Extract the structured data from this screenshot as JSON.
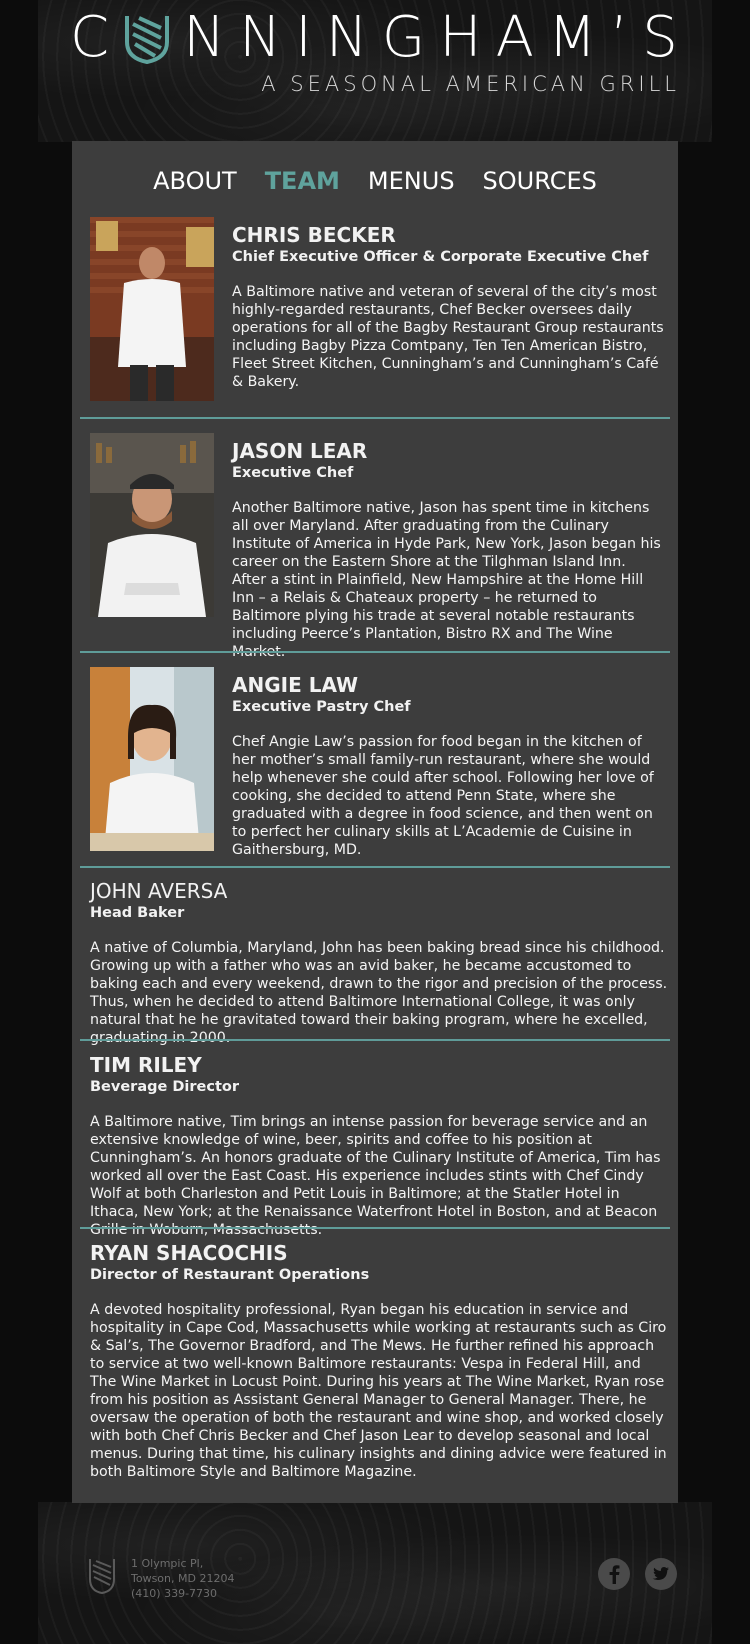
{
  "brand": {
    "letters_left": "C",
    "letters_right": [
      "N",
      "N",
      "I",
      "N",
      "G",
      "H",
      "A",
      "M",
      "’",
      "S"
    ],
    "tagline": "A SEASONAL AMERICAN GRILL",
    "accent_color": "#5fa39d"
  },
  "nav": {
    "items": [
      {
        "label": "ABOUT",
        "active": false
      },
      {
        "label": "TEAM",
        "active": true
      },
      {
        "label": "MENUS",
        "active": false
      },
      {
        "label": "SOURCES",
        "active": false
      }
    ]
  },
  "team": [
    {
      "name": "CHRIS BECKER",
      "role": "Chief Executive Officer & Corporate Executive Chef",
      "bio": "A Baltimore native and veteran of several of the city’s most highly-regarded restaurants, Chef Becker oversees daily operations for all of the Bagby Restaurant Group restaurants including Bagby Pizza Comtpany, Ten Ten American Bistro, Fleet Street Kitchen, Cunningham’s and Cunningham’s Café & Bakery."
    },
    {
      "name": "JASON LEAR",
      "role": "Executive Chef",
      "bio": "Another Baltimore native, Jason has spent time in kitchens all over Maryland. After graduating from the Culinary Institute of America in Hyde Park, New York, Jason began his career on the Eastern Shore at the Tilghman Island Inn. After a stint in Plainfield, New Hampshire at the Home Hill Inn – a Relais & Chateaux property – he returned to Baltimore plying his trade at several notable restaurants including Peerce’s Plantation, Bistro RX and The Wine Market."
    },
    {
      "name": "ANGIE LAW",
      "role": "Executive Pastry Chef",
      "bio": "Chef Angie Law’s passion for food began in the kitchen of her mother’s small family-run restaurant, where she would help whenever she could after school. Following her love of cooking, she decided to attend Penn State, where she graduated with a degree in food science, and then went on to perfect her culinary skills at L’Academie de Cuisine in Gaithersburg, MD."
    },
    {
      "name": "JOHN AVERSA",
      "role": "Head Baker",
      "bio": "A native of Columbia, Maryland, John has been baking bread since his childhood. Growing up with a father who was an avid baker, he became accustomed to baking each and every weekend, drawn to the rigor and precision of the process. Thus, when he decided to attend Baltimore International College, it was only natural that he he gravitated toward their baking program, where he excelled, graduating in 2000."
    },
    {
      "name": "TIM RILEY",
      "role": "Beverage Director",
      "bio": "A Baltimore native, Tim brings an intense passion for beverage service and an extensive knowledge of wine, beer, spirits and coffee to his position at Cunningham’s. An honors graduate of the Culinary Institute of America, Tim has worked all over the East Coast. His experience includes stints with Chef Cindy Wolf at both Charleston and Petit Louis in Baltimore; at the Statler Hotel in Ithaca, New York; at the Renaissance Waterfront Hotel in Boston, and at Beacon Grille in Woburn, Massachusetts."
    },
    {
      "name": "RYAN SHACOCHIS",
      "role": "Director of Restaurant Operations",
      "bio": "A devoted hospitality professional, Ryan began his education in service and hospitality in Cape Cod, Massachusetts while working at restaurants such as Ciro & Sal’s, The Governor Bradford, and The Mews. He further refined his approach to service at two well-known Baltimore restaurants: Vespa in Federal Hill, and The Wine Market in Locust Point. During his years at The Wine Market, Ryan rose from his position as Assistant General Manager to General Manager. There, he oversaw the operation of both the restaurant and wine shop, and worked closely with both Chef Chris Becker and Chef Jason Lear to develop seasonal and local menus. During that time, his culinary insights and dining advice were featured in both Baltimore Style and Baltimore Magazine."
    }
  ],
  "footer": {
    "address_line1": "1 Olympic Pl,",
    "address_line2": "Towson, MD 21204",
    "phone": "(410) 339-7730",
    "social": [
      {
        "name": "facebook-icon",
        "glyph": "f"
      },
      {
        "name": "twitter-icon",
        "glyph": "t"
      }
    ]
  }
}
